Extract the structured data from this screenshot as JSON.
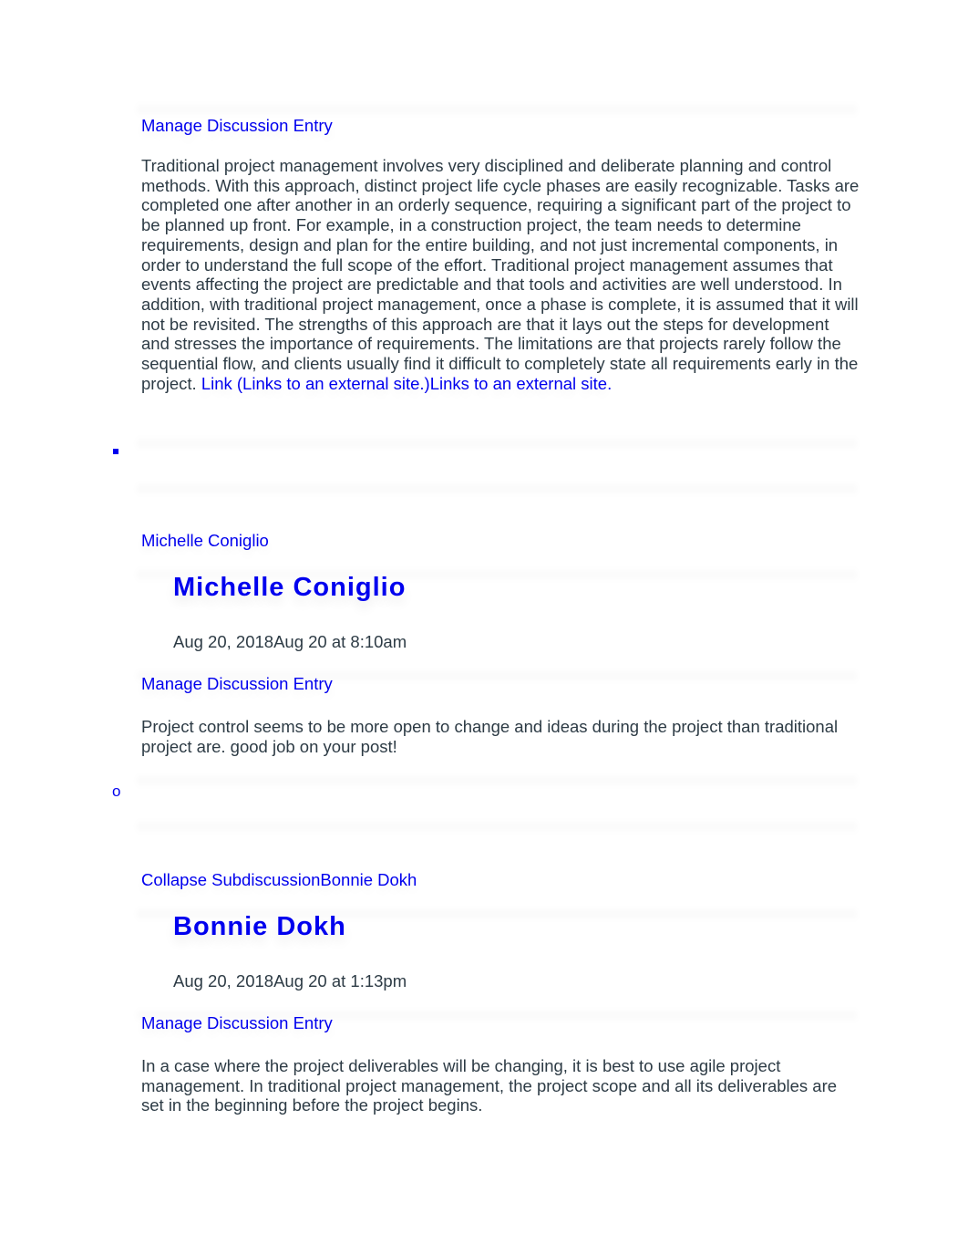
{
  "entries": [
    {
      "manage_label": "Manage Discussion Entry",
      "body": "Traditional project management involves very disciplined and deliberate planning and control methods. With this approach, distinct project life cycle phases are easily recognizable. Tasks are completed one after another in an orderly sequence, requiring a significant part of the project to be planned up front. For example, in a construction project, the team needs to determine requirements, design and plan for the entire building, and not just incremental components, in order to understand the full scope of the effort. Traditional project management assumes that events affecting the project are predictable and that tools and activities are well understood. In addition, with traditional project management, once a phase is complete, it is assumed that it will not be revisited. The strengths of this approach are that it lays out the steps for development and stresses the importance of requirements. The limitations are that projects rarely follow the sequential flow, and clients usually find it difficult to completely state all requirements early in the project. ",
      "link_text": "Link (Links to an external site.)Links to an external site."
    },
    {
      "bullet": "square",
      "author_link": "Michelle Coniglio",
      "author_heading": "Michelle Coniglio",
      "timestamp": "Aug 20, 2018Aug 20 at 8:10am",
      "manage_label": "Manage Discussion Entry",
      "body": "Project control seems to be more open to change and ideas during the project than traditional project are. good job on your post!"
    },
    {
      "bullet": "o",
      "author_link": "Collapse SubdiscussionBonnie Dokh",
      "author_heading": "Bonnie Dokh",
      "timestamp": "Aug 20, 2018Aug 20 at 1:13pm",
      "manage_label": "Manage Discussion Entry",
      "body": "In a case where the project deliverables will be changing, it is best to use agile project management. In traditional project management, the project scope and all its deliverables are set in the beginning before the project begins."
    }
  ],
  "colors": {
    "link": "#0000ee",
    "text": "#2d3b45"
  }
}
